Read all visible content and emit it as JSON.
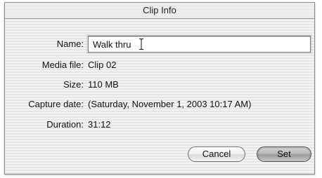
{
  "window": {
    "title": "Clip Info"
  },
  "fields": {
    "name": {
      "label": "Name:",
      "value": "Walk thru"
    },
    "media_file": {
      "label": "Media file:",
      "value": "Clip 02"
    },
    "size": {
      "label": "Size:",
      "value": "110 MB"
    },
    "capture_date": {
      "label": "Capture date:",
      "value": "(Saturday, November 1, 2003 10:17 AM)"
    },
    "duration": {
      "label": "Duration:",
      "value": "31:12"
    }
  },
  "buttons": {
    "cancel_label": "Cancel",
    "set_label": "Set"
  },
  "icons": {
    "cursor": "text-cursor-icon"
  }
}
